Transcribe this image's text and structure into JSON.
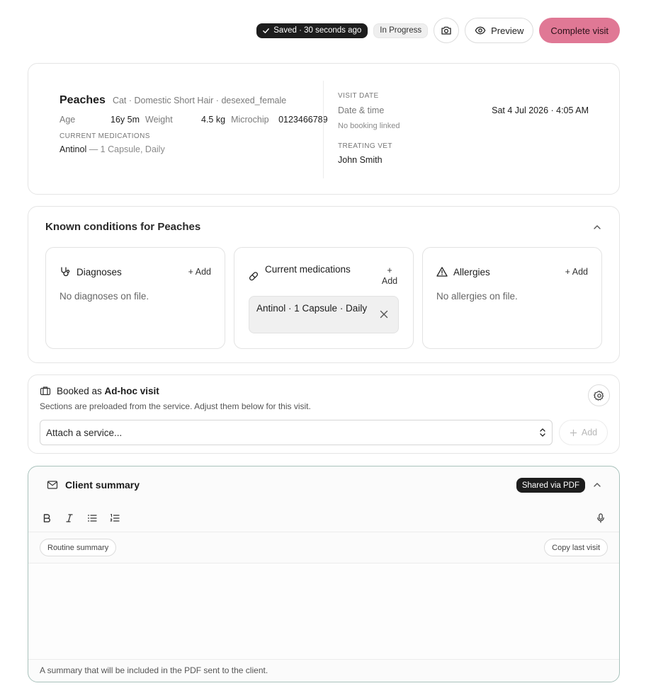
{
  "topbar": {
    "saved_status": "Saved · 30 seconds ago",
    "visit_status": "In Progress",
    "preview_label": "Preview",
    "complete_label": "Complete visit"
  },
  "patient": {
    "name": "Peaches",
    "meta": "Cat · Domestic Short Hair · desexed_female",
    "age_label": "Age",
    "age_value": "16y 5m",
    "weight_label": "Weight",
    "weight_value": "4.5 kg",
    "microchip_label": "Microchip",
    "microchip_value": "0123466789",
    "medications_label": "CURRENT MEDICATIONS",
    "medication_name": "Antinol",
    "medication_dose": " — 1 Capsule, Daily"
  },
  "visit": {
    "date_label": "VISIT DATE",
    "datetime_label": "Date & time",
    "datetime_value": "Sat 4 Jul 2026 · 4:05 AM",
    "booking_note": "No booking linked",
    "vet_label": "TREATING VET",
    "vet_name": "John Smith"
  },
  "conditions": {
    "title": "Known conditions for Peaches",
    "diagnoses": {
      "label": "Diagnoses",
      "add": "+ Add",
      "empty": "No diagnoses on file."
    },
    "medications": {
      "label": "Current medications",
      "add": "+ Add",
      "chip": "Antinol · 1 Capsule · Daily"
    },
    "allergies": {
      "label": "Allergies",
      "add": "+ Add",
      "empty": "No allergies on file."
    }
  },
  "booking": {
    "prefix": "Booked as ",
    "type": "Ad-hoc visit",
    "note": "Sections are preloaded from the service. Adjust them below for this visit.",
    "select_value": "Attach a service...",
    "add_label": "Add"
  },
  "summary": {
    "title": "Client summary",
    "shared_badge": "Shared via PDF",
    "template_chip": "Routine summary",
    "copy_chip": "Copy last visit",
    "footer": "A summary that will be included in the PDF sent to the client."
  },
  "colors": {
    "accent": "#e07895",
    "dark_pill": "#1d1d1d",
    "summary_border": "#a9c2bc"
  },
  "icons": [
    "check-icon",
    "camera-icon",
    "eye-icon",
    "chevron-up-icon",
    "stethoscope-icon",
    "pill-icon",
    "close-icon",
    "warning-icon",
    "briefcase-icon",
    "gear-icon",
    "chevron-updown-icon",
    "plus-icon",
    "mail-icon",
    "bold-icon",
    "italic-icon",
    "bullet-list-icon",
    "numbered-list-icon",
    "microphone-icon"
  ]
}
